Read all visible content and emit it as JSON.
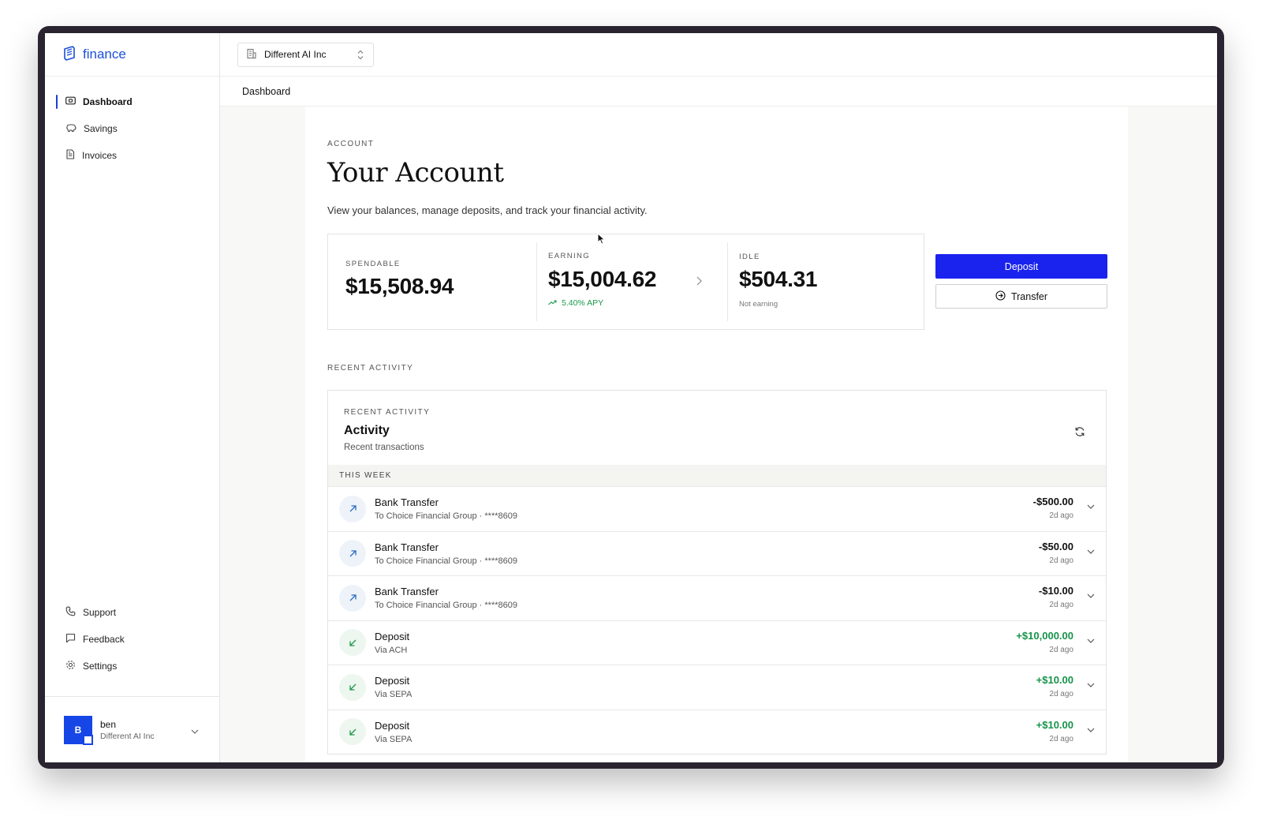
{
  "brand": {
    "name": "finance"
  },
  "sidebar": {
    "nav": [
      {
        "label": "Dashboard",
        "icon": "wallet-icon",
        "active": true
      },
      {
        "label": "Savings",
        "icon": "piggy-bank-icon",
        "active": false
      },
      {
        "label": "Invoices",
        "icon": "document-icon",
        "active": false
      }
    ],
    "bottom": [
      {
        "label": "Support",
        "icon": "phone-icon"
      },
      {
        "label": "Feedback",
        "icon": "message-icon"
      },
      {
        "label": "Settings",
        "icon": "gear-icon"
      }
    ],
    "user": {
      "initial": "B",
      "name": "ben",
      "org": "Different AI Inc"
    }
  },
  "topbar": {
    "org": "Different AI Inc"
  },
  "breadcrumb": "Dashboard",
  "account": {
    "eyebrow": "ACCOUNT",
    "title": "Your Account",
    "subtitle": "View your balances, manage deposits, and track your financial activity."
  },
  "balances": {
    "spendable": {
      "label": "SPENDABLE",
      "value": "$15,508.94"
    },
    "earning": {
      "label": "EARNING",
      "value": "$15,004.62",
      "apy": "5.40% APY"
    },
    "idle": {
      "label": "IDLE",
      "value": "$504.31",
      "note": "Not earning"
    }
  },
  "actions": {
    "deposit": "Deposit",
    "transfer": "Transfer"
  },
  "recent": {
    "section_label": "RECENT ACTIVITY",
    "card_eyebrow": "RECENT ACTIVITY",
    "title": "Activity",
    "subtitle": "Recent transactions",
    "group": "THIS WEEK",
    "transactions": [
      {
        "title": "Bank Transfer",
        "desc": "To Choice Financial Group · ****8609",
        "amount": "-$500.00",
        "time": "2d ago",
        "direction": "out"
      },
      {
        "title": "Bank Transfer",
        "desc": "To Choice Financial Group · ****8609",
        "amount": "-$50.00",
        "time": "2d ago",
        "direction": "out"
      },
      {
        "title": "Bank Transfer",
        "desc": "To Choice Financial Group · ****8609",
        "amount": "-$10.00",
        "time": "2d ago",
        "direction": "out"
      },
      {
        "title": "Deposit",
        "desc": "Via ACH",
        "amount": "+$10,000.00",
        "time": "2d ago",
        "direction": "in"
      },
      {
        "title": "Deposit",
        "desc": "Via SEPA",
        "amount": "+$10.00",
        "time": "2d ago",
        "direction": "in"
      },
      {
        "title": "Deposit",
        "desc": "Via SEPA",
        "amount": "+$10.00",
        "time": "2d ago",
        "direction": "in"
      }
    ]
  },
  "colors": {
    "accent": "#1a22ee",
    "brand": "#1a4fd8",
    "positive": "#15934a"
  }
}
